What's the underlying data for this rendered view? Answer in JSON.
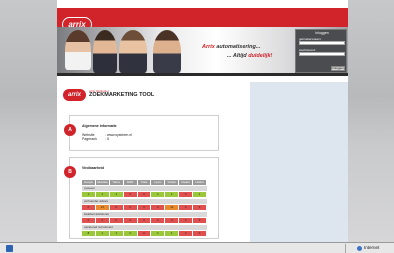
{
  "header": {
    "logo_text": "arrix",
    "slogan_brand": "Arrix",
    "slogan_line1_rest": "automatisering...",
    "slogan_line2_prefix": "... Altijd",
    "slogan_line2_accent": "duidelijk!"
  },
  "login": {
    "title": "Inloggen",
    "user_label": "gebruikersnaam:",
    "password_label": "wachtwoord:",
    "button_label": "Inloggen"
  },
  "tool": {
    "logo_text": "arrix",
    "subtitle": "Arrix Optimizer",
    "title": "ZOEKMARKETING TOOL"
  },
  "section_a": {
    "badge": "A",
    "title": "Algemene informatie",
    "website_label": "Website",
    "website_value": ": www.systeem.nl",
    "pagerank_label": "Pagerank",
    "pagerank_value": ": 5"
  },
  "section_b": {
    "badge": "B",
    "title": "Vindbaarheid",
    "columns": [
      "Google",
      "Altavista",
      "Yahoo",
      "MSN",
      "Track",
      "Lycos",
      "Vinden",
      "Ilsekar",
      "Hotbot"
    ],
    "groups": [
      {
        "label": "systeem",
        "cells": [
          {
            "v": "1",
            "c": "#9bc73b"
          },
          {
            "v": "1",
            "c": "#9bc73b"
          },
          {
            "v": "1",
            "c": "#9bc73b"
          },
          {
            "v": "0",
            "c": "#e0504f"
          },
          {
            "v": "0",
            "c": "#e0504f"
          },
          {
            "v": "1",
            "c": "#9bc73b"
          },
          {
            "v": "1",
            "c": "#9bc73b"
          },
          {
            "v": "0",
            "c": "#e0504f"
          },
          {
            "v": "1",
            "c": "#9bc73b"
          }
        ]
      },
      {
        "label": "verhuurder advies",
        "cells": [
          {
            "v": "0",
            "c": "#e0504f"
          },
          {
            "v": "13",
            "c": "#e98a2f"
          },
          {
            "v": "0",
            "c": "#e0504f"
          },
          {
            "v": "0",
            "c": "#e0504f"
          },
          {
            "v": "0",
            "c": "#e0504f"
          },
          {
            "v": "0",
            "c": "#e0504f"
          },
          {
            "v": "12",
            "c": "#e98a2f"
          },
          {
            "v": "0",
            "c": "#e0504f"
          },
          {
            "v": "0",
            "c": "#e0504f"
          }
        ]
      },
      {
        "label": "kwaliteit advisieren",
        "cells": [
          {
            "v": "0",
            "c": "#e0504f"
          },
          {
            "v": "0",
            "c": "#e0504f"
          },
          {
            "v": "0",
            "c": "#e0504f"
          },
          {
            "v": "0",
            "c": "#e0504f"
          },
          {
            "v": "0",
            "c": "#e0504f"
          },
          {
            "v": "0",
            "c": "#e0504f"
          },
          {
            "v": "0",
            "c": "#e0504f"
          },
          {
            "v": "0",
            "c": "#e0504f"
          },
          {
            "v": "0",
            "c": "#e0504f"
          }
        ]
      },
      {
        "label": "vacatured recruitment",
        "cells": [
          {
            "v": "8",
            "c": "#9bc73b"
          },
          {
            "v": "1",
            "c": "#9bc73b"
          },
          {
            "v": "1",
            "c": "#9bc73b"
          },
          {
            "v": "2",
            "c": "#9bc73b"
          },
          {
            "v": "0",
            "c": "#e0504f"
          },
          {
            "v": "1",
            "c": "#9bc73b"
          },
          {
            "v": "1",
            "c": "#9bc73b"
          },
          {
            "v": "0",
            "c": "#e0504f"
          },
          {
            "v": "0",
            "c": "#e0504f"
          }
        ]
      }
    ]
  },
  "statusbar": {
    "zone": "Internet"
  }
}
